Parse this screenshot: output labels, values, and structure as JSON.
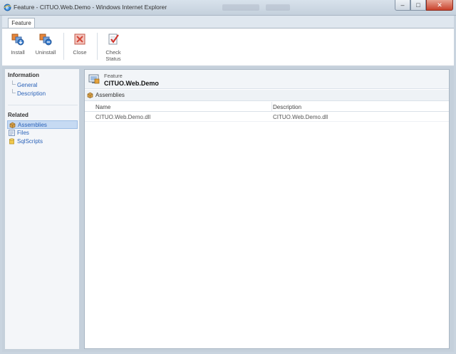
{
  "window": {
    "title": "Feature - CITUO.Web.Demo - Windows Internet Explorer",
    "minimize_glyph": "–",
    "maximize_glyph": "□",
    "close_glyph": "✕"
  },
  "ribbon": {
    "tab_label": "Feature",
    "buttons": [
      {
        "label": "Install",
        "icon": "install-icon"
      },
      {
        "label": "Uninstall",
        "icon": "uninstall-icon"
      },
      {
        "label": "Close",
        "icon": "close-icon"
      },
      {
        "label_line1": "Check",
        "label_line2": "Status",
        "icon": "check-status-icon"
      }
    ]
  },
  "sidebar": {
    "information_heading": "Information",
    "information_links": [
      "General",
      "Description"
    ],
    "related_heading": "Related",
    "related_items": [
      {
        "label": "Assemblies",
        "icon": "assembly-icon",
        "selected": true
      },
      {
        "label": "Files",
        "icon": "file-icon",
        "selected": false
      },
      {
        "label": "SqlScripts",
        "icon": "database-icon",
        "selected": false
      }
    ]
  },
  "main": {
    "entity_type": "Feature",
    "entity_name": "CITUO.Web.Demo",
    "section_title": "Assemblies",
    "columns": [
      "Name",
      "Description"
    ],
    "rows": [
      {
        "name": "CITUO.Web.Demo.dll",
        "description": "CITUO.Web.Demo.dll"
      }
    ]
  },
  "colors": {
    "link": "#2a62b8",
    "selection": "#c6daf3",
    "chrome": "#c5d0db"
  }
}
